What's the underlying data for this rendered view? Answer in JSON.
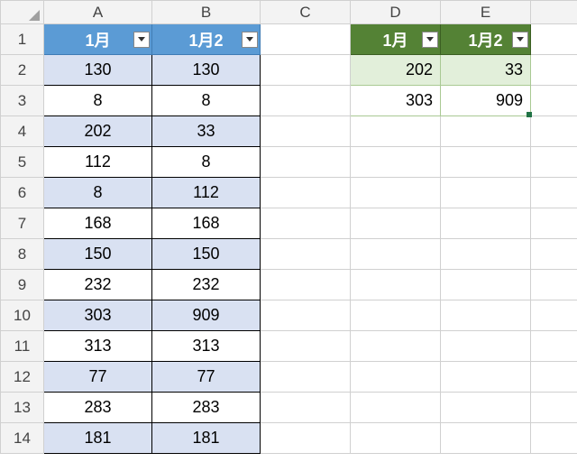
{
  "columns": [
    "A",
    "B",
    "C",
    "D",
    "E"
  ],
  "row_numbers": [
    "1",
    "2",
    "3",
    "4",
    "5",
    "6",
    "7",
    "8",
    "9",
    "10",
    "11",
    "12",
    "13",
    "14"
  ],
  "table1": {
    "headers": [
      "1月",
      "1月2"
    ],
    "rows": [
      [
        "130",
        "130"
      ],
      [
        "8",
        "8"
      ],
      [
        "202",
        "33"
      ],
      [
        "112",
        "8"
      ],
      [
        "8",
        "112"
      ],
      [
        "168",
        "168"
      ],
      [
        "150",
        "150"
      ],
      [
        "232",
        "232"
      ],
      [
        "303",
        "909"
      ],
      [
        "313",
        "313"
      ],
      [
        "77",
        "77"
      ],
      [
        "283",
        "283"
      ],
      [
        "181",
        "181"
      ]
    ]
  },
  "table2": {
    "headers": [
      "1月",
      "1月2"
    ],
    "rows": [
      [
        "202",
        "33"
      ],
      [
        "303",
        "909"
      ]
    ]
  }
}
